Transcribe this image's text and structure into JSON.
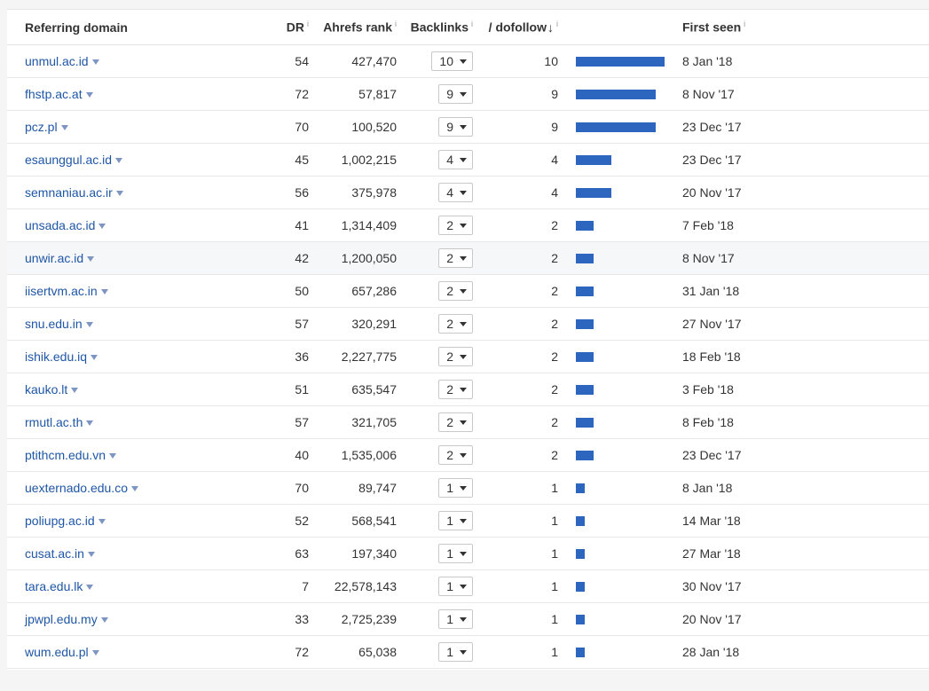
{
  "columns": {
    "domain": "Referring domain",
    "dr": "DR",
    "rank": "Ahrefs rank",
    "backlinks": "Backlinks",
    "dofollow": "/ dofollow",
    "first_seen": "First seen",
    "info": "i",
    "sort_arrow": "↓"
  },
  "bar_max": 10,
  "colors": {
    "link": "#1f56a6",
    "bar": "#2d66be"
  },
  "rows": [
    {
      "domain": "unmul.ac.id",
      "dr": "54",
      "rank": "427,470",
      "backlinks": "10",
      "dofollow": 10,
      "first_seen": "8 Jan '18"
    },
    {
      "domain": "fhstp.ac.at",
      "dr": "72",
      "rank": "57,817",
      "backlinks": "9",
      "dofollow": 9,
      "first_seen": "8 Nov '17"
    },
    {
      "domain": "pcz.pl",
      "dr": "70",
      "rank": "100,520",
      "backlinks": "9",
      "dofollow": 9,
      "first_seen": "23 Dec '17"
    },
    {
      "domain": "esaunggul.ac.id",
      "dr": "45",
      "rank": "1,002,215",
      "backlinks": "4",
      "dofollow": 4,
      "first_seen": "23 Dec '17"
    },
    {
      "domain": "semnaniau.ac.ir",
      "dr": "56",
      "rank": "375,978",
      "backlinks": "4",
      "dofollow": 4,
      "first_seen": "20 Nov '17"
    },
    {
      "domain": "unsada.ac.id",
      "dr": "41",
      "rank": "1,314,409",
      "backlinks": "2",
      "dofollow": 2,
      "first_seen": "7 Feb '18"
    },
    {
      "domain": "unwir.ac.id",
      "dr": "42",
      "rank": "1,200,050",
      "backlinks": "2",
      "dofollow": 2,
      "first_seen": "8 Nov '17"
    },
    {
      "domain": "iisertvm.ac.in",
      "dr": "50",
      "rank": "657,286",
      "backlinks": "2",
      "dofollow": 2,
      "first_seen": "31 Jan '18"
    },
    {
      "domain": "snu.edu.in",
      "dr": "57",
      "rank": "320,291",
      "backlinks": "2",
      "dofollow": 2,
      "first_seen": "27 Nov '17"
    },
    {
      "domain": "ishik.edu.iq",
      "dr": "36",
      "rank": "2,227,775",
      "backlinks": "2",
      "dofollow": 2,
      "first_seen": "18 Feb '18"
    },
    {
      "domain": "kauko.lt",
      "dr": "51",
      "rank": "635,547",
      "backlinks": "2",
      "dofollow": 2,
      "first_seen": "3 Feb '18"
    },
    {
      "domain": "rmutl.ac.th",
      "dr": "57",
      "rank": "321,705",
      "backlinks": "2",
      "dofollow": 2,
      "first_seen": "8 Feb '18"
    },
    {
      "domain": "ptithcm.edu.vn",
      "dr": "40",
      "rank": "1,535,006",
      "backlinks": "2",
      "dofollow": 2,
      "first_seen": "23 Dec '17"
    },
    {
      "domain": "uexternado.edu.co",
      "dr": "70",
      "rank": "89,747",
      "backlinks": "1",
      "dofollow": 1,
      "first_seen": "8 Jan '18"
    },
    {
      "domain": "poliupg.ac.id",
      "dr": "52",
      "rank": "568,541",
      "backlinks": "1",
      "dofollow": 1,
      "first_seen": "14 Mar '18"
    },
    {
      "domain": "cusat.ac.in",
      "dr": "63",
      "rank": "197,340",
      "backlinks": "1",
      "dofollow": 1,
      "first_seen": "27 Mar '18"
    },
    {
      "domain": "tara.edu.lk",
      "dr": "7",
      "rank": "22,578,143",
      "backlinks": "1",
      "dofollow": 1,
      "first_seen": "30 Nov '17"
    },
    {
      "domain": "jpwpl.edu.my",
      "dr": "33",
      "rank": "2,725,239",
      "backlinks": "1",
      "dofollow": 1,
      "first_seen": "20 Nov '17"
    },
    {
      "domain": "wum.edu.pl",
      "dr": "72",
      "rank": "65,038",
      "backlinks": "1",
      "dofollow": 1,
      "first_seen": "28 Jan '18"
    }
  ]
}
